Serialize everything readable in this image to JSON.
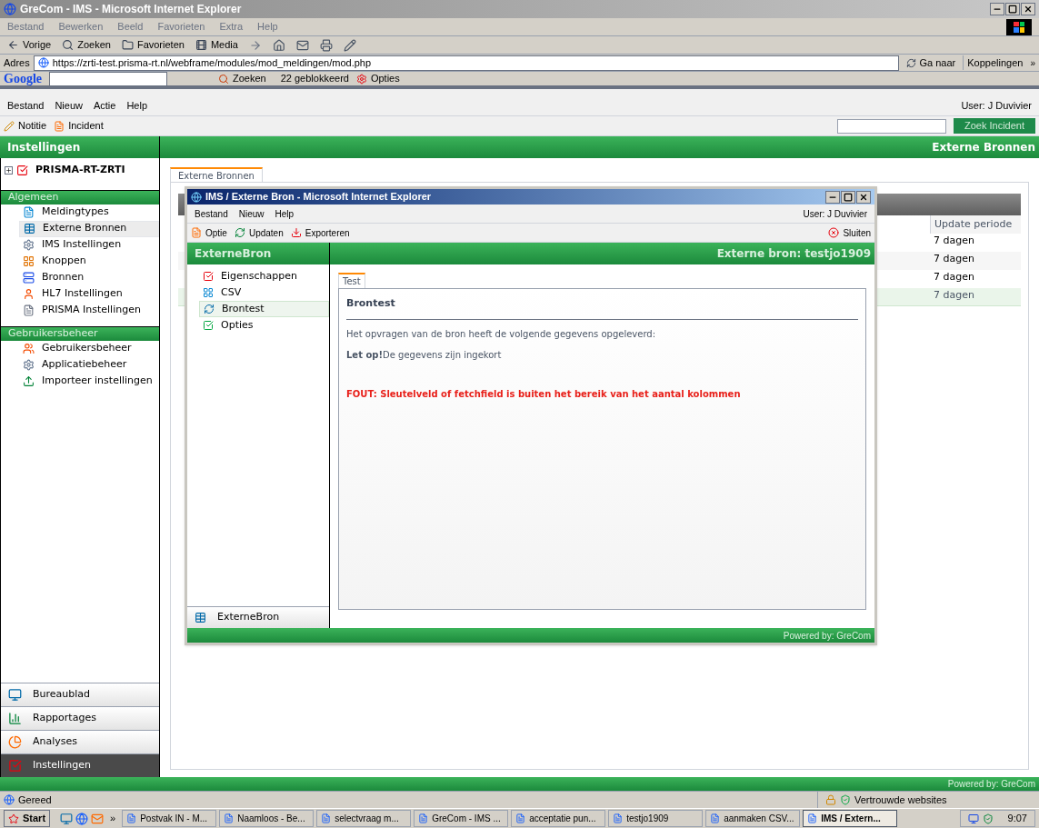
{
  "browser": {
    "title": "GreCom - IMS - Microsoft Internet Explorer",
    "menu": [
      "Bestand",
      "Bewerken",
      "Beeld",
      "Favorieten",
      "Extra",
      "Help"
    ],
    "toolbar": [
      "Vorige",
      "Zoeken",
      "Favorieten",
      "Media"
    ],
    "address": {
      "label": "Adres",
      "url": "https://zrti-test.prisma-rt.nl/webframe/modules/mod_meldingen/mod.php",
      "go": "Ga naar",
      "links": "Koppelingen",
      "more": "»"
    },
    "google": {
      "logo": "Google",
      "search": "Zoeken",
      "blocked": "22 geblokkeerd",
      "options": "Opties"
    }
  },
  "app": {
    "menu": [
      "Bestand",
      "Nieuw",
      "Actie",
      "Help"
    ],
    "user": "User: J Duvivier",
    "toolbar": [
      "Notitie",
      "Incident"
    ],
    "search_button": "Zoek Incident",
    "header_left": "Instellingen",
    "header_right": "Externe Bronnen"
  },
  "sidebar": {
    "tree": {
      "label": "PRISMA-RT-ZRTI",
      "expanded": false
    },
    "groups": [
      {
        "title": "Algemeen",
        "items": [
          {
            "label": "Meldingtypes",
            "selected": false
          },
          {
            "label": "Externe Bronnen",
            "selected": true
          },
          {
            "label": "IMS Instellingen",
            "selected": false
          },
          {
            "label": "Knoppen",
            "selected": false
          },
          {
            "label": "Bronnen",
            "selected": false
          },
          {
            "label": "HL7 Instellingen",
            "selected": false
          },
          {
            "label": "PRISMA Instellingen",
            "selected": false
          }
        ]
      },
      {
        "title": "Gebruikersbeheer",
        "items": [
          {
            "label": "Gebruikersbeheer",
            "selected": false
          },
          {
            "label": "Applicatiebeheer",
            "selected": false
          },
          {
            "label": "Importeer instellingen",
            "selected": false
          }
        ]
      }
    ],
    "bottom_nav": [
      {
        "label": "Bureaublad",
        "selected": false
      },
      {
        "label": "Rapportages",
        "selected": false
      },
      {
        "label": "Analyses",
        "selected": false
      },
      {
        "label": "Instellingen",
        "selected": true
      }
    ]
  },
  "main": {
    "tab": {
      "label": "Externe Bronnen",
      "selected": true
    },
    "table": {
      "columns": [
        "Update periode"
      ],
      "rows": [
        {
          "cells": [
            "7 dagen"
          ],
          "selected": false
        },
        {
          "cells": [
            "7 dagen"
          ],
          "selected": false
        },
        {
          "cells": [
            "7 dagen"
          ],
          "selected": false
        },
        {
          "cells": [
            "7 dagen"
          ],
          "selected": true
        }
      ]
    }
  },
  "popup": {
    "title": "IMS / Externe Bron - Microsoft Internet Explorer",
    "menu": [
      "Bestand",
      "Nieuw",
      "Help"
    ],
    "user": "User: J Duvivier",
    "toolbar": [
      "Optie",
      "Updaten",
      "Exporteren"
    ],
    "close": "Sluiten",
    "nav_title": "ExterneBron",
    "heading": "Externe bron: testjo1909",
    "nav": [
      {
        "label": "Eigenschappen",
        "selected": false
      },
      {
        "label": "CSV",
        "selected": false
      },
      {
        "label": "Brontest",
        "selected": true
      },
      {
        "label": "Opties",
        "selected": false
      }
    ],
    "nav_footer": "ExterneBron",
    "tab": {
      "label": "Test",
      "selected": true
    },
    "section_title": "Brontest",
    "intro": "Het opvragen van de bron heeft de volgende gegevens opgeleverd:",
    "note": "**Let op!**De gegevens zijn ingekort",
    "error": "FOUT: Sleutelveld of fetchfield is buiten het bereik van het aantal kolommen",
    "footer": "Powered by: GreCom"
  },
  "footer": "Powered by: GreCom",
  "status": {
    "text": "Gereed",
    "zone": "Vertrouwde websites"
  },
  "taskbar": {
    "start": "Start",
    "more": "»",
    "tasks": [
      {
        "label": "Postvak IN - M...",
        "selected": false
      },
      {
        "label": "Naamloos - Be...",
        "selected": false
      },
      {
        "label": "selectvraag m...",
        "selected": false
      },
      {
        "label": "GreCom - IMS ...",
        "selected": false
      },
      {
        "label": "acceptatie pun...",
        "selected": false
      },
      {
        "label": "testjo1909",
        "selected": false
      },
      {
        "label": "aanmaken CSV...",
        "selected": false
      },
      {
        "label": "IMS / Extern...",
        "selected": true
      }
    ],
    "clock": "9:07"
  }
}
